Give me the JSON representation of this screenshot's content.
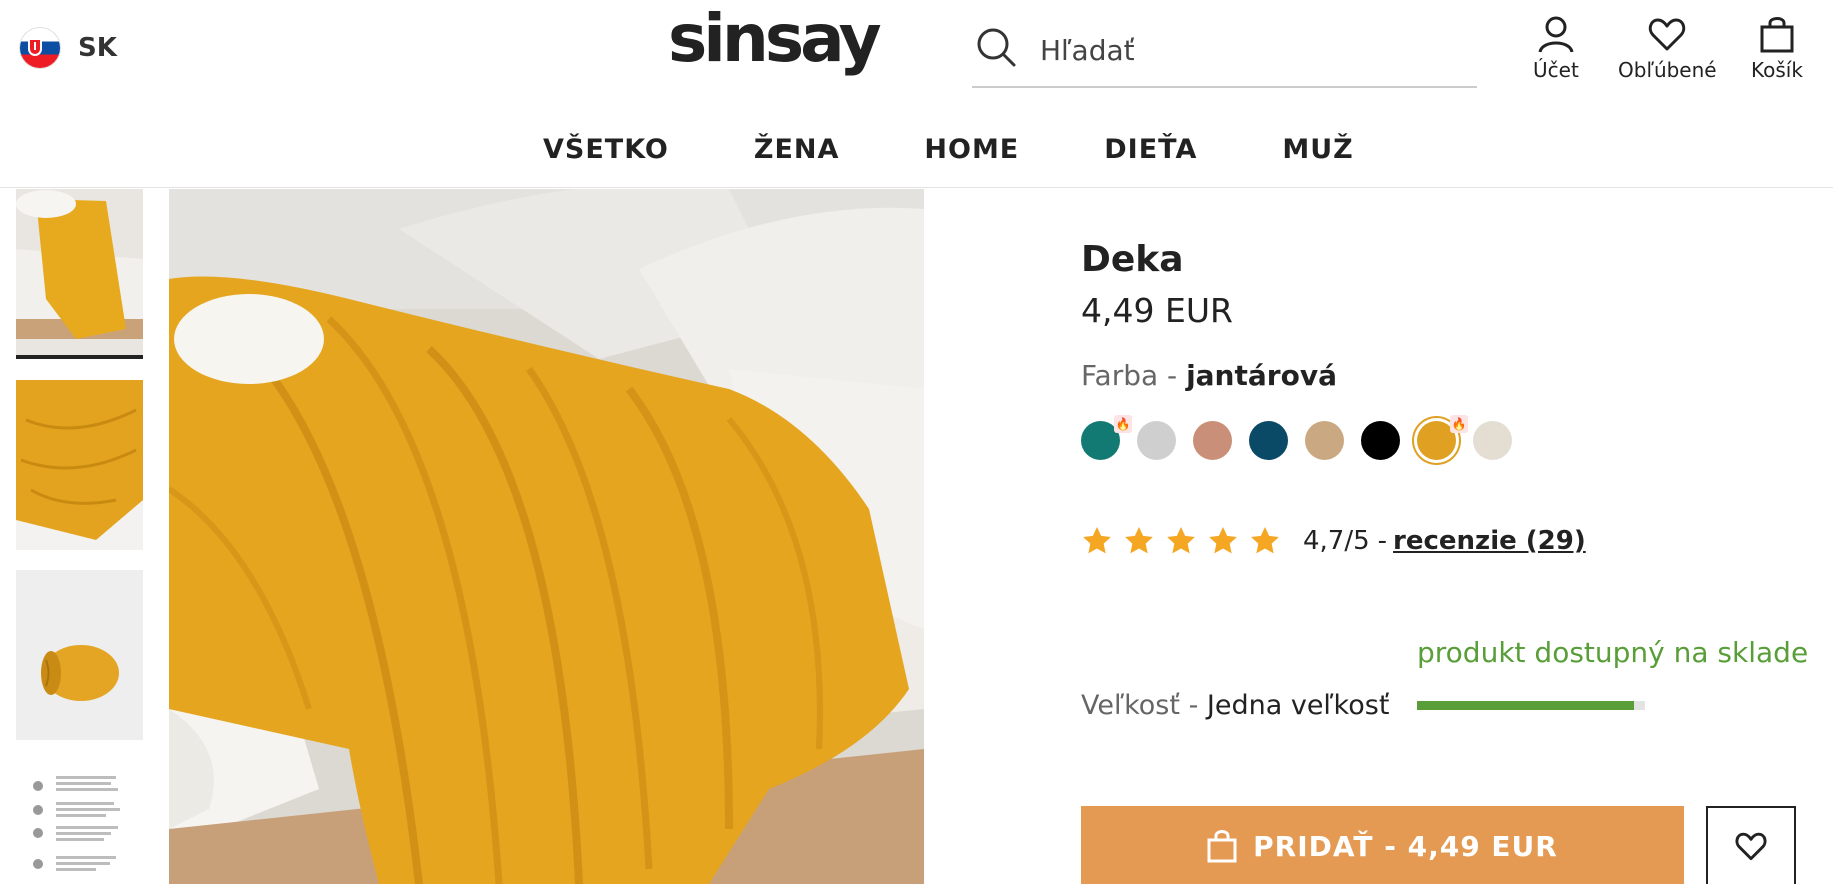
{
  "header": {
    "lang_code": "SK",
    "logo": "sinsay",
    "search_placeholder": "Hľadať",
    "account_label": "Účet",
    "favorites_label": "Obľúbené",
    "cart_label": "Košík"
  },
  "nav": {
    "items": [
      "VŠETKO",
      "ŽENA",
      "HOME",
      "DIEŤA",
      "MUŽ"
    ]
  },
  "product": {
    "title": "Deka",
    "price": "4,49 EUR",
    "color_label": "Farba",
    "color_value": "jantárová",
    "swatches": [
      {
        "color": "#127a72",
        "hot": true
      },
      {
        "color": "#cfcfcf",
        "hot": false
      },
      {
        "color": "#c98f78",
        "hot": false
      },
      {
        "color": "#0b4a66",
        "hot": false
      },
      {
        "color": "#c9a882",
        "hot": false
      },
      {
        "color": "#000000",
        "hot": false
      },
      {
        "color": "#e0a021",
        "hot": true,
        "selected": true
      },
      {
        "color": "#e4ddd2",
        "hot": false
      }
    ],
    "rating": {
      "stars": 5,
      "score": "4,7/5",
      "separator": "-",
      "reviews": "recenzie (29)"
    },
    "stock_text": "produkt dostupný na sklade",
    "stock_level": 0.95,
    "size_label": "Veľkosť",
    "size_value": "Jedna veľkosť",
    "add_button": "PRIDAŤ - 4,49 EUR"
  },
  "colors": {
    "accent_orange": "#e59a53",
    "star": "#f5a623",
    "stock_green": "#5a9e3a",
    "mustard": "#e0a021"
  }
}
